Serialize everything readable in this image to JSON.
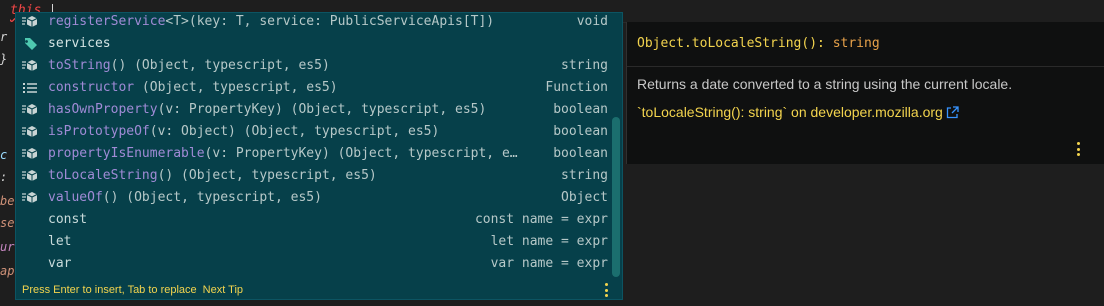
{
  "editor": {
    "keyword": "this",
    "dot": "."
  },
  "gutter": [
    "r",
    "}",
    "c",
    ":",
    "be",
    "se",
    "ur",
    "ap"
  ],
  "suggest": {
    "items": [
      {
        "name": "registerService",
        "rest": "<T>(key: T, service: PublicServiceApis[T])",
        "detail": "void",
        "icon": "method-cube-icon"
      },
      {
        "name": "services",
        "rest": "",
        "detail": "",
        "icon": "property-tag-icon"
      },
      {
        "name": "toString",
        "rest": "() (Object, typescript, es5)",
        "detail": "string",
        "icon": "method-cube-icon"
      },
      {
        "name": "constructor",
        "rest": " (Object, typescript, es5)",
        "detail": "Function",
        "icon": "list-icon"
      },
      {
        "name": "hasOwnProperty",
        "rest": "(v: PropertyKey) (Object, typescript, es5)",
        "detail": "boolean",
        "icon": "method-cube-icon"
      },
      {
        "name": "isPrototypeOf",
        "rest": "(v: Object) (Object, typescript, es5)",
        "detail": "boolean",
        "icon": "method-cube-icon"
      },
      {
        "name": "propertyIsEnumerable",
        "rest": "(v: PropertyKey) (Object, typescript, e…",
        "detail": "boolean",
        "icon": "method-cube-icon"
      },
      {
        "name": "toLocaleString",
        "rest": "() (Object, typescript, es5)",
        "detail": "string",
        "icon": "method-cube-icon"
      },
      {
        "name": "valueOf",
        "rest": "() (Object, typescript, es5)",
        "detail": "Object",
        "icon": "method-cube-icon"
      },
      {
        "name": "const",
        "rest": "",
        "detail": "const name = expr",
        "icon": ""
      },
      {
        "name": "let",
        "rest": "",
        "detail": "let name = expr",
        "icon": ""
      },
      {
        "name": "var",
        "rest": "",
        "detail": "var name = expr",
        "icon": ""
      }
    ],
    "status_text": "Press Enter to insert, Tab to replace",
    "next_tip": "Next Tip"
  },
  "details": {
    "signature_name": "Object.toLocaleString",
    "signature_parens": "(): ",
    "signature_return": "string",
    "description": "Returns a date converted to a string using the current locale.",
    "link_text": "`toLocaleString(): string` on developer.mozilla.org"
  },
  "colors": {
    "accent": "#f3d44e",
    "widget_bg": "#06404a",
    "method_purple": "#a08bd6",
    "error_red": "#f44747"
  }
}
